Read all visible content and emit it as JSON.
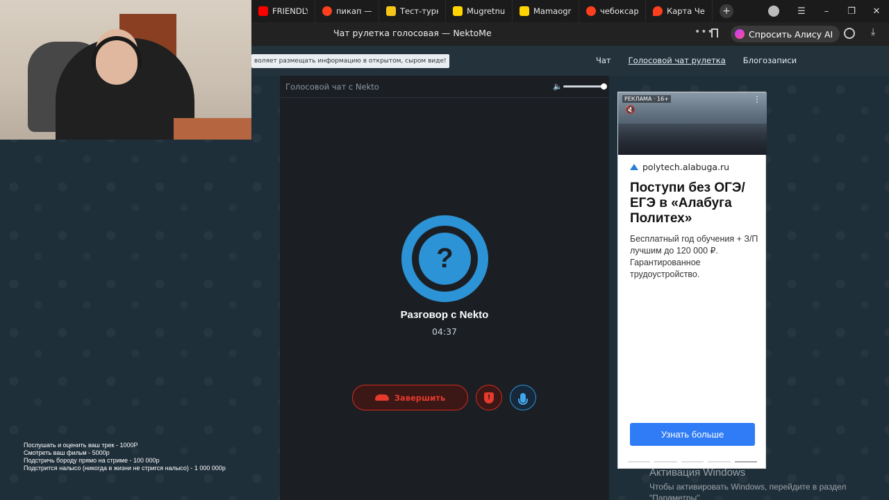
{
  "browser": {
    "tabs": [
      {
        "label": "FRIENDLY T",
        "icon": "youtube-icon",
        "color": "#ff0000"
      },
      {
        "label": "пикап — Ян",
        "icon": "yandex-icon",
        "color": "#fc3f1d"
      },
      {
        "label": "Тест-турни",
        "icon": "star-icon",
        "color": "#f5c518"
      },
      {
        "label": "Mugretnug",
        "icon": "twitch-like-icon",
        "color": "#ffd400"
      },
      {
        "label": "Mamaogra",
        "icon": "twitch-like-icon",
        "color": "#ffd400"
      },
      {
        "label": "чебоксары",
        "icon": "yandex-icon",
        "color": "#fc3f1d"
      },
      {
        "label": "Карта Чебо",
        "icon": "map-pin-icon",
        "color": "#fc3f1d"
      }
    ],
    "new_tab": "+",
    "page_title": "Чат рулетка голосовая — NektoMe",
    "alice_button": "Спросить Алису AI"
  },
  "site": {
    "notice": "воляет размещать информацию в открытом, сыром виде!",
    "nav": [
      {
        "label": "Чат",
        "active": false
      },
      {
        "label": "Голосовой чат рулетка",
        "active": true
      },
      {
        "label": "Блогозаписи",
        "active": false
      }
    ]
  },
  "chat": {
    "panel_title": "Голосовой чат с Nekto",
    "avatar_symbol": "?",
    "conversation_name": "Разговор с Nekto",
    "timer": "04:37",
    "end_button": "Завершить",
    "accent": "#2c93d6",
    "danger": "#e53a2d"
  },
  "ad": {
    "label": "РЕКЛАМА · 16+",
    "domain": "polytech.alabuga.ru",
    "headline": "Поступи без ОГЭ/ЕГЭ в «Алабуга Политех»",
    "body": "Бесплатный год обучения + З/П лучшим до 120 000 ₽. Гарантированное трудоустройство.",
    "cta": "Узнать больше"
  },
  "overlay": {
    "lines": [
      "Послушать и оценить ваш трек - 1000Р",
      "Смотреть ваш фильм - 5000р",
      "Подстричь бороду прямо на стриме - 100 000р",
      "Подстрится налысо (никогда в жизни не стригся налысо) - 1 000 000р"
    ]
  },
  "watermark": {
    "title": "Активация Windows",
    "subtitle_1": "Чтобы активировать Windows, перейдите в раздел",
    "subtitle_2": "\"Параметры\"."
  }
}
